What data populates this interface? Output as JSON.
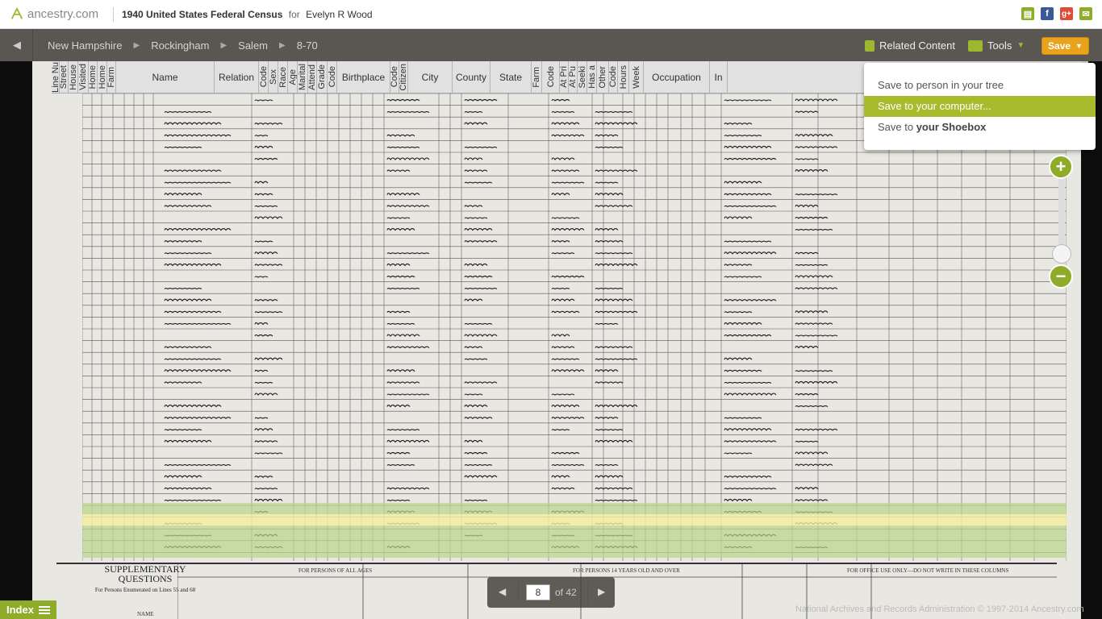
{
  "header": {
    "brand": "ancestry.com",
    "record_title": "1940 United States Federal Census",
    "for_label": "for",
    "person": "Evelyn R Wood"
  },
  "breadcrumbs": [
    "New Hampshire",
    "Rockingham",
    "Salem",
    "8-70"
  ],
  "toolbar": {
    "related_label": "Related Content",
    "tools_label": "Tools",
    "save_label": "Save"
  },
  "save_menu": {
    "items": [
      {
        "prefix": "Save to person in your tree",
        "bold": ""
      },
      {
        "prefix": "Save to your computer...",
        "bold": ""
      },
      {
        "prefix": "Save to ",
        "bold": "your Shoebox"
      }
    ],
    "active_index": 1
  },
  "columns": [
    {
      "label": "Line Nu",
      "vertical": true
    },
    {
      "label": "Street",
      "vertical": true
    },
    {
      "label": "House",
      "vertical": true
    },
    {
      "label": "Visited",
      "vertical": true
    },
    {
      "label": "Home",
      "vertical": true
    },
    {
      "label": "Home",
      "vertical": true
    },
    {
      "label": "Farm",
      "vertical": true
    },
    {
      "label": "Name",
      "vertical": false
    },
    {
      "label": "Relation",
      "vertical": false
    },
    {
      "label": "Code",
      "vertical": true
    },
    {
      "label": "Sex",
      "vertical": true
    },
    {
      "label": "Race",
      "vertical": true
    },
    {
      "label": "Age",
      "vertical": true
    },
    {
      "label": "Marital",
      "vertical": true
    },
    {
      "label": "Attend",
      "vertical": true
    },
    {
      "label": "Grade",
      "vertical": true
    },
    {
      "label": "Code",
      "vertical": true
    },
    {
      "label": "Birthplace",
      "vertical": false
    },
    {
      "label": "Code",
      "vertical": true
    },
    {
      "label": "Citizen",
      "vertical": true
    },
    {
      "label": "City",
      "vertical": false
    },
    {
      "label": "County",
      "vertical": false
    },
    {
      "label": "State",
      "vertical": false
    },
    {
      "label": "Farm",
      "vertical": true
    },
    {
      "label": "Code",
      "vertical": true
    },
    {
      "label": "At Pri",
      "vertical": true
    },
    {
      "label": "At Pu",
      "vertical": true
    },
    {
      "label": "Seeki",
      "vertical": true
    },
    {
      "label": "Has a",
      "vertical": true
    },
    {
      "label": "Other",
      "vertical": true
    },
    {
      "label": "Code",
      "vertical": true
    },
    {
      "label": "Hours",
      "vertical": true
    },
    {
      "label": "Week",
      "vertical": true
    },
    {
      "label": "Occupation",
      "vertical": false
    },
    {
      "label": "In",
      "vertical": false
    }
  ],
  "census_footer": {
    "supp_title": "SUPPLEMENTARY QUESTIONS",
    "supp_sub": "For Persons Enumerated on Lines 55 and 68",
    "sec1": "FOR PERSONS OF ALL AGES",
    "sec2": "FOR PERSONS 14 YEARS OLD AND OVER",
    "sec3": "FOR OFFICE USE ONLY—DO NOT WRITE IN THESE COLUMNS",
    "name_label": "NAME"
  },
  "pager": {
    "current": "8",
    "of_label": "of 42"
  },
  "index_label": "Index",
  "copyright": "National Archives and Records Administration  © 1997-2014 Ancestry.com"
}
